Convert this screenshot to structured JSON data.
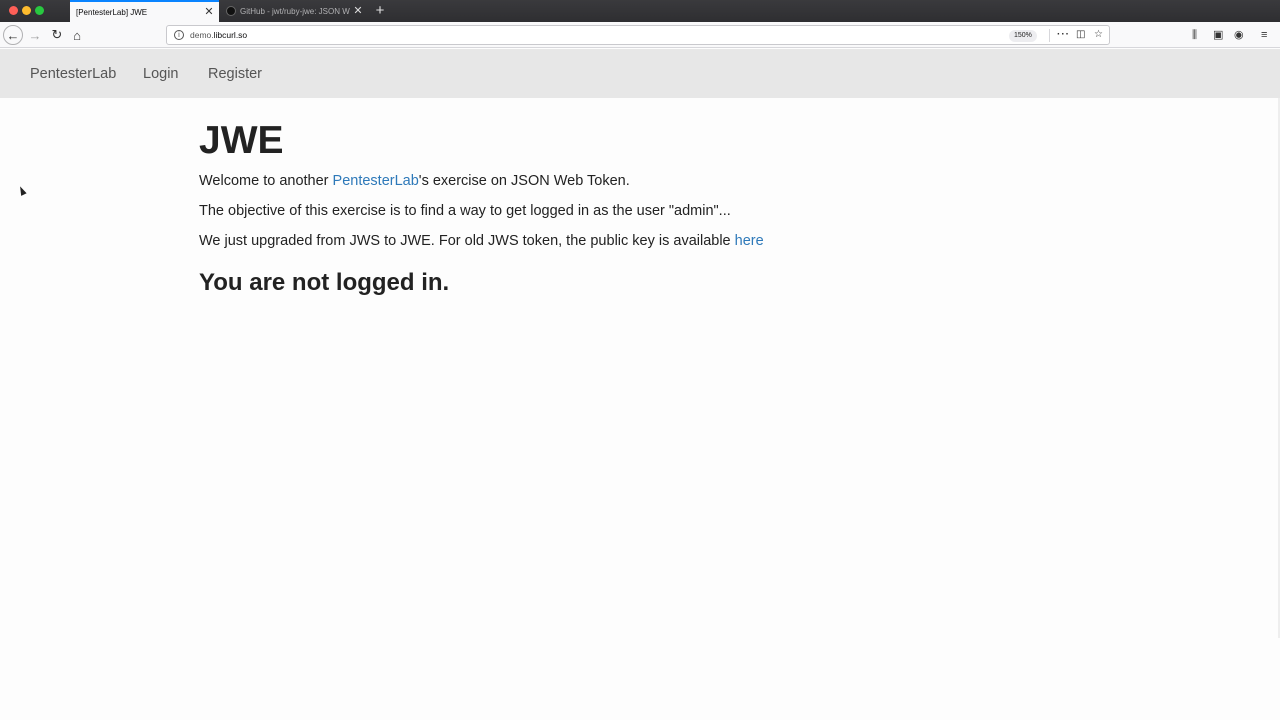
{
  "browser": {
    "tabs": [
      {
        "title": "[PentesterLab] JWE",
        "active": true
      },
      {
        "title": "GitHub - jwt/ruby-jwe: JSON W",
        "active": false
      }
    ],
    "close_glyph": "✕",
    "new_tab_glyph": "+",
    "url_host_prefix": "demo.",
    "url_host_domain": "libcurl.so",
    "zoom": "150%",
    "icons": {
      "back": "back-arrow-icon",
      "forward": "forward-arrow-icon",
      "reload": "reload-icon",
      "home": "home-icon",
      "info": "info-icon",
      "more": "more-icon",
      "pocket": "pocket-icon",
      "star": "star-icon",
      "library": "library-icon",
      "sidebar": "sidebar-icon",
      "account": "account-icon",
      "menu": "hamburger-menu-icon"
    }
  },
  "site_nav": {
    "brand": "PentesterLab",
    "login": "Login",
    "register": "Register"
  },
  "content": {
    "title": "JWE",
    "p1_before": "Welcome to another ",
    "p1_link": "PentesterLab",
    "p1_after": "'s exercise on JSON Web Token.",
    "p2": "The objective of this exercise is to find a way to get logged in as the user \"admin\"...",
    "p3_before": "We just upgraded from JWS to JWE. For old JWS token, the public key is available ",
    "p3_link": "here",
    "status": "You are not logged in."
  }
}
